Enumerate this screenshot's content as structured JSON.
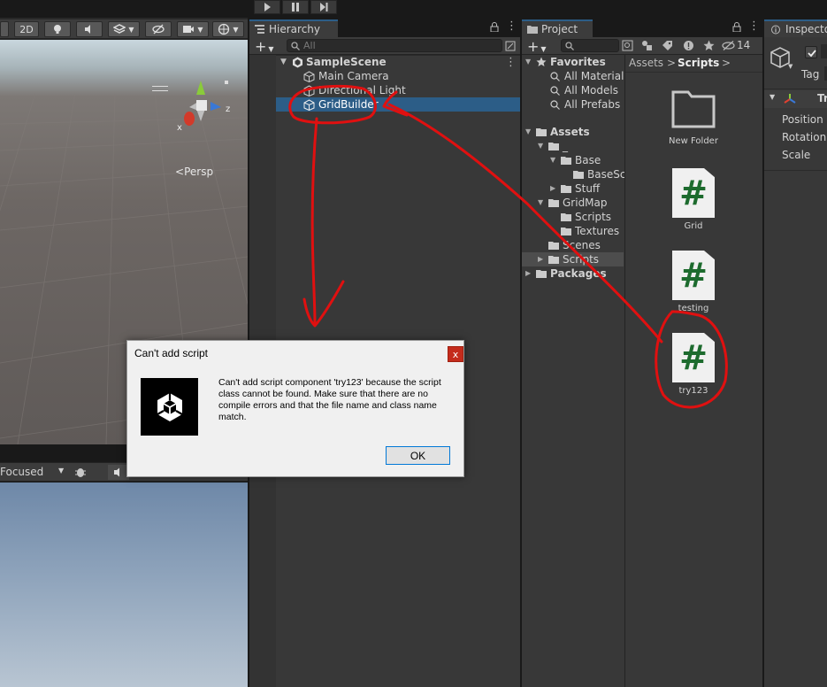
{
  "toolbar": {
    "play_icon": "play-icon",
    "pause_icon": "pause-icon",
    "step_icon": "step-icon"
  },
  "scene": {
    "btn_2d": "2D",
    "persp_label": "Persp",
    "gizmo_x": "x",
    "gizmo_z": "z"
  },
  "game": {
    "focus_label": "Focused"
  },
  "hierarchy": {
    "tab_label": "Hierarchy",
    "search_placeholder": "All",
    "scene_name": "SampleScene",
    "items": [
      {
        "label": "Main Camera"
      },
      {
        "label": "Directional Light"
      },
      {
        "label": "GridBuilder"
      }
    ]
  },
  "project": {
    "tab_label": "Project",
    "count": "14",
    "favorites_label": "Favorites",
    "favorites": [
      "All Materials",
      "All Models",
      "All Prefabs"
    ],
    "assets_label": "Assets",
    "tree": {
      "underscore": "_",
      "base": "Base",
      "base_sub": "BaseSc",
      "stuff": "Stuff",
      "gridmap": "GridMap",
      "gm_scripts": "Scripts",
      "gm_textures": "Textures",
      "scenes": "Scenes",
      "scripts": "Scripts",
      "packages": "Packages"
    },
    "breadcrumb": [
      "Assets",
      "Scripts"
    ],
    "assets": [
      {
        "label": "New Folder"
      },
      {
        "label": "Grid"
      },
      {
        "label": "testing"
      },
      {
        "label": "try123"
      }
    ],
    "script_glyph": "#"
  },
  "inspector": {
    "tab_label": "Inspecto",
    "tag_label": "Tag",
    "component_label": "Tr",
    "fields": [
      "Position",
      "Rotation",
      "Scale"
    ]
  },
  "dialog": {
    "title": "Can't add script",
    "close_label": "x",
    "message": "Can't add script component 'try123' because the script class cannot be found. Make sure that there are no compile errors and that the file name and class name match.",
    "ok_label": "OK"
  },
  "colors": {
    "selection": "#2c5d87",
    "annotation": "#e01010",
    "script_hash": "#1d6b2e"
  }
}
